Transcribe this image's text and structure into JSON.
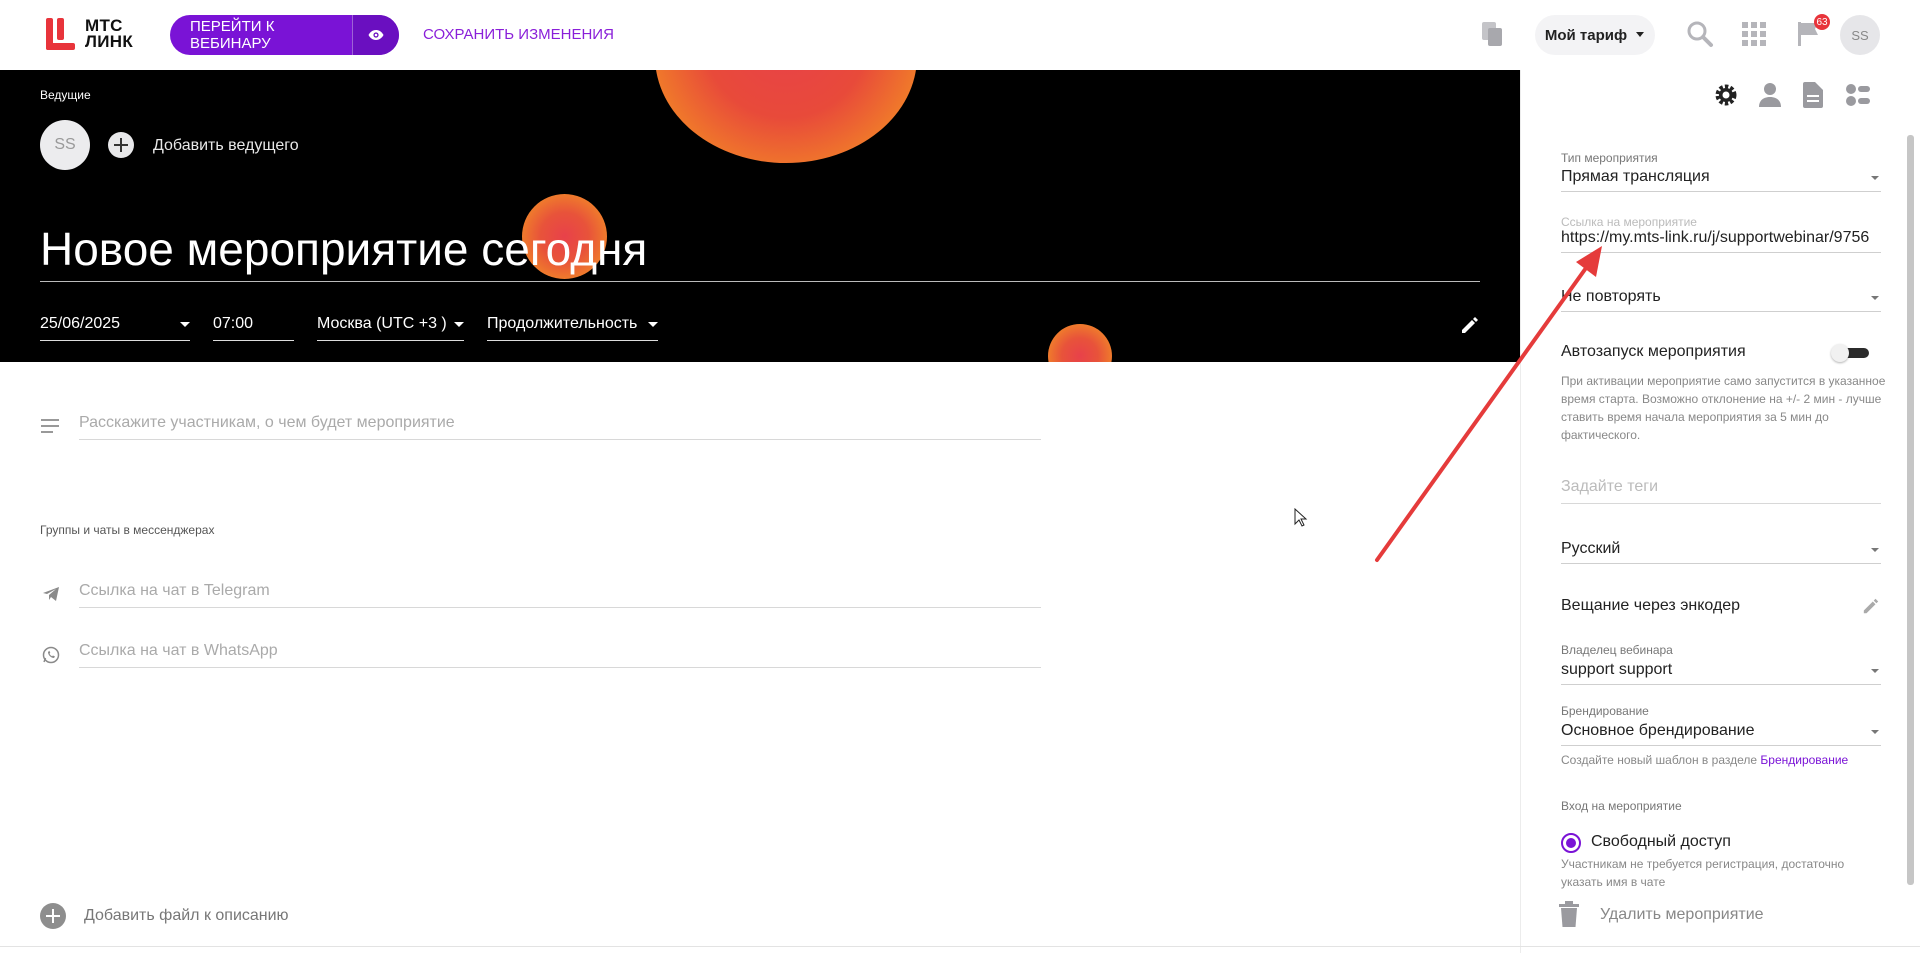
{
  "header": {
    "logo_line1": "МТС",
    "logo_line2": "ЛИНК",
    "webinar_button": "ПЕРЕЙТИ К ВЕБИНАРУ",
    "save_link": "СОХРАНИТЬ ИЗМЕНЕНИЯ",
    "tariff": "Мой тариф",
    "notifications_count": "63",
    "avatar": "SS"
  },
  "banner": {
    "hosts_label": "Ведущие",
    "host_avatar": "SS",
    "add_host": "Добавить ведущего",
    "title": "Новое мероприятие сегодня",
    "date": "25/06/2025",
    "time": "07:00",
    "timezone": "Москва (UTC +3 )",
    "duration": "Продолжительность"
  },
  "main": {
    "description_placeholder": "Расскажите участникам, о чем будет мероприятие",
    "groups_label": "Группы и чаты в мессенджерах",
    "telegram_placeholder": "Ссылка на чат в Telegram",
    "whatsapp_placeholder": "Ссылка на чат в WhatsApp",
    "add_file": "Добавить файл к описанию"
  },
  "panel": {
    "event_type_label": "Тип мероприятия",
    "event_type_value": "Прямая трансляция",
    "event_link_label": "Ссылка на мероприятие",
    "event_link_value": "https://my.mts-link.ru/j/supportwebinar/9756",
    "repeat_value": "Не повторять",
    "autostart_title": "Автозапуск мероприятия",
    "autostart_hint": "При активации мероприятие само запустится в указанное время старта. Возможно отклонение на +/- 2 мин - лучше ставить время начала мероприятия за 5 мин до фактического.",
    "tags_placeholder": "Задайте теги",
    "language_value": "Русский",
    "encoder_title": "Вещание через энкодер",
    "owner_label": "Владелец вебинара",
    "owner_value": "support support",
    "branding_label": "Брендирование",
    "branding_value": "Основное брендирование",
    "branding_hint": "Создайте новый шаблон в разделе",
    "branding_link": "Брендирование",
    "access_label": "Вход на мероприятие",
    "access_option": "Свободный доступ",
    "access_hint": "Участникам не требуется регистрация, достаточно указать имя в чате",
    "delete_label": "Удалить мероприятие"
  },
  "colors": {
    "accent": "#7a13d6",
    "logo_red": "#e8343b",
    "annotation_arrow": "#e53b3b"
  }
}
